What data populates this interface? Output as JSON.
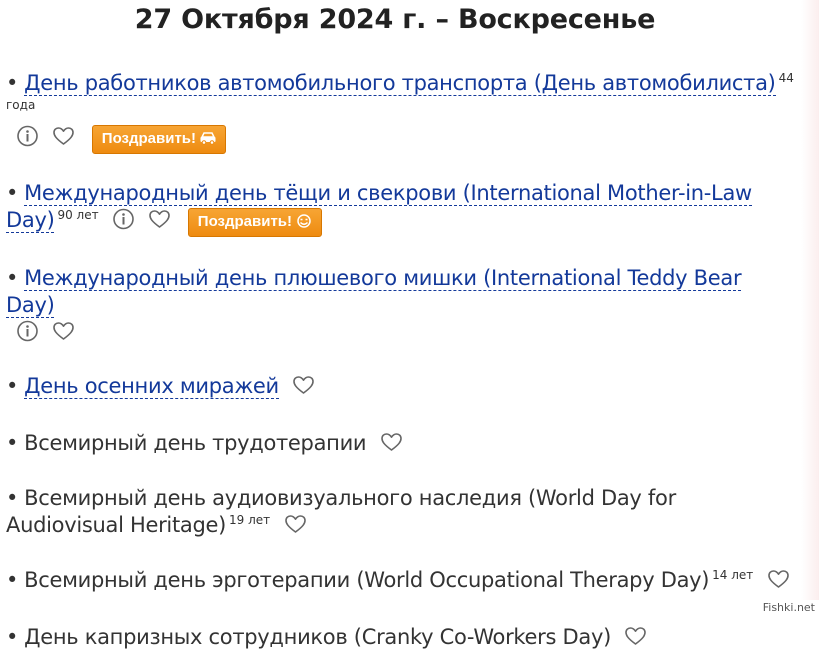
{
  "header": {
    "title": "27 Октября 2024 г. – Воскресенье"
  },
  "bullet": "•",
  "holidays": [
    {
      "name": "День работников автомобильного транспорта (День автомобилиста)",
      "link": true,
      "years": "44 года",
      "info": true,
      "favorite": true,
      "congratulate": "Поздравить!",
      "button_icon": "car-icon"
    },
    {
      "name": "Международный день тёщи и свекрови (International Mother-in-Law Day)",
      "link": true,
      "years": "90 лет",
      "info": true,
      "favorite": true,
      "congratulate": "Поздравить!",
      "button_icon": "smiley-icon"
    },
    {
      "name": "Международный день плюшевого мишки (International Teddy Bear Day)",
      "link": true,
      "years": "",
      "info": true,
      "favorite": true
    },
    {
      "name": "День осенних миражей",
      "link": true,
      "years": "",
      "info": false,
      "favorite": true
    },
    {
      "name": "Всемирный день трудотерапии",
      "link": false,
      "years": "",
      "info": false,
      "favorite": true
    },
    {
      "name": "Всемирный день аудиовизуального наследия (World Day for Audiovisual Heritage)",
      "link": false,
      "years": "19 лет",
      "info": false,
      "favorite": true
    },
    {
      "name": "Всемирный день эрготерапии (World Occupational Therapy Day)",
      "link": false,
      "years": "14 лет",
      "info": false,
      "favorite": true
    },
    {
      "name": "День капризных сотрудников (Cranky Co-Workers Day)",
      "link": false,
      "years": "",
      "info": false,
      "favorite": true
    }
  ],
  "watermark": "Fishki.net",
  "colors": {
    "link": "#13399a",
    "button": "#f29418",
    "text": "#333333"
  }
}
